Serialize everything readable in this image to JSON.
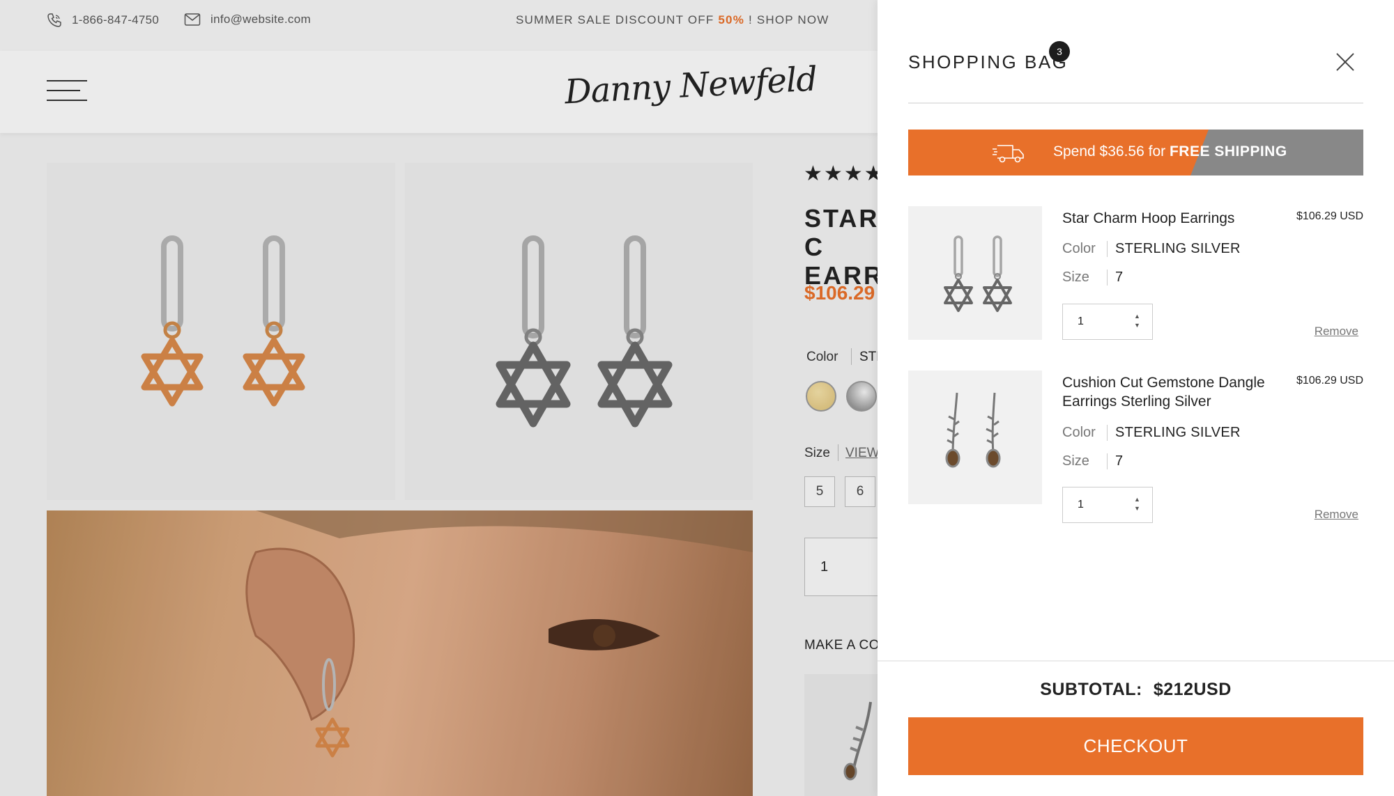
{
  "topbar": {
    "phone": "1-866-847-4750",
    "email": "info@website.com",
    "promo_prefix": "SUMMER SALE DISCOUNT OFF",
    "promo_pct": "50%",
    "promo_suffix": "! SHOP NOW"
  },
  "header": {
    "logo": "Danny Newfeld"
  },
  "product": {
    "stars": "★★★★",
    "title_line1": "STAR C",
    "title_line2": "EARRI",
    "price": "$106.29",
    "color_label": "Color",
    "color_value": "STE",
    "size_label": "Size",
    "size_link": "VIEW",
    "sizes": [
      "5",
      "6"
    ],
    "qty": "1",
    "make_label": "MAKE A CO"
  },
  "cart": {
    "title": "SHOPPING BAG",
    "count": "3",
    "shipping": {
      "prefix": "Spend $36.56 for",
      "bold": "FREE SHIPPING",
      "progress": 0.66
    },
    "items": [
      {
        "name": "Star Charm Hoop Earrings",
        "price": "$106.29 USD",
        "color_label": "Color",
        "color_value": "STERLING SILVER",
        "size_label": "Size",
        "size_value": "7",
        "qty": "1",
        "remove": "Remove"
      },
      {
        "name": "Cushion Cut Gemstone Dangle Earrings Sterling Silver",
        "price": "$106.29 USD",
        "color_label": "Color",
        "color_value": "STERLING SILVER",
        "size_label": "Size",
        "size_value": "7",
        "qty": "1",
        "remove": "Remove"
      }
    ],
    "subtotal_label": "SUBTOTAL:",
    "subtotal_value": "$212USD",
    "checkout": "CHECKOUT"
  },
  "colors": {
    "accent": "#e8702a",
    "dark": "#1d1d1d",
    "progress_track": "#888888"
  }
}
